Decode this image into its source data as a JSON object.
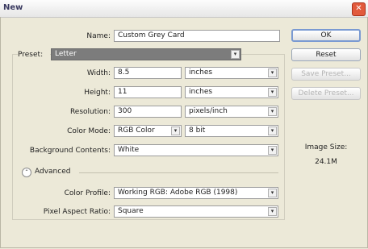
{
  "window": {
    "title": "New",
    "close_glyph": "✕"
  },
  "form": {
    "name_label": "Name:",
    "name_value": "Custom Grey Card",
    "preset_label": "Preset:",
    "preset_value": "Letter",
    "width_label": "Width:",
    "width_value": "8.5",
    "width_unit": "inches",
    "height_label": "Height:",
    "height_value": "11",
    "height_unit": "inches",
    "resolution_label": "Resolution:",
    "resolution_value": "300",
    "resolution_unit": "pixels/inch",
    "color_mode_label": "Color Mode:",
    "color_mode_value": "RGB Color",
    "bit_depth_value": "8 bit",
    "background_label": "Background Contents:",
    "background_value": "White",
    "advanced_label": "Advanced",
    "advanced_glyph": "⌃",
    "color_profile_label": "Color Profile:",
    "color_profile_value": "Working RGB:  Adobe RGB (1998)",
    "aspect_label": "Pixel Aspect Ratio:",
    "aspect_value": "Square"
  },
  "buttons": {
    "ok": "OK",
    "reset": "Reset",
    "save_preset": "Save Preset...",
    "delete_preset": "Delete Preset..."
  },
  "image_size": {
    "label": "Image Size:",
    "value": "24.1M"
  },
  "icons": {
    "dropdown_glyph": "▾"
  }
}
